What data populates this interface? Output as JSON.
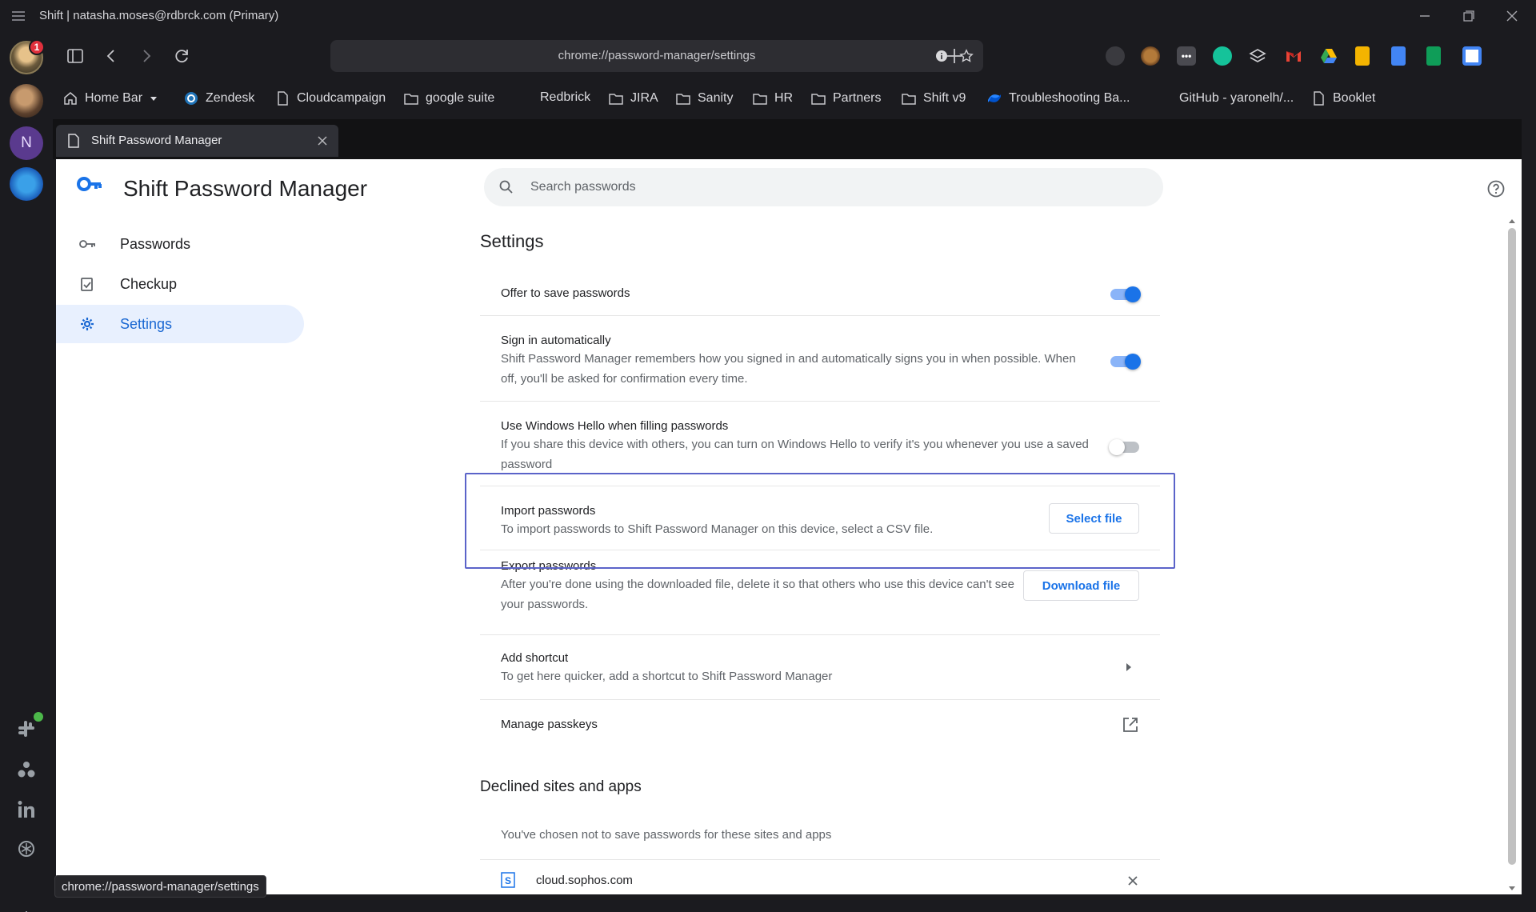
{
  "window": {
    "title": "Shift | natasha.moses@rdbrck.com (Primary)"
  },
  "rail": {
    "badge_count": "1",
    "account_initial": "N"
  },
  "toolbar": {
    "url": "chrome://password-manager/settings"
  },
  "bookmarks": [
    {
      "label": "Home Bar",
      "icon": "home-icon"
    },
    {
      "label": "Zendesk",
      "icon": "zendesk-icon"
    },
    {
      "label": "Cloudcampaign",
      "icon": "page-icon"
    },
    {
      "label": "google suite",
      "icon": "folder-icon"
    },
    {
      "label": "Redbrick",
      "icon": "none"
    },
    {
      "label": "JIRA",
      "icon": "folder-icon"
    },
    {
      "label": "Sanity",
      "icon": "folder-icon"
    },
    {
      "label": "HR",
      "icon": "folder-icon"
    },
    {
      "label": "Partners",
      "icon": "folder-icon"
    },
    {
      "label": "Shift v9",
      "icon": "folder-icon"
    },
    {
      "label": "Troubleshooting Ba...",
      "icon": "confluence-icon"
    },
    {
      "label": "GitHub - yaronelh/...",
      "icon": "github-icon"
    },
    {
      "label": "Booklet",
      "icon": "page-icon"
    }
  ],
  "tab": {
    "label": "Shift Password Manager"
  },
  "app": {
    "name": "Shift Password Manager",
    "search_placeholder": "Search passwords",
    "nav": [
      {
        "label": "Passwords",
        "icon": "key-icon"
      },
      {
        "label": "Checkup",
        "icon": "checkup-icon"
      },
      {
        "label": "Settings",
        "icon": "gear-icon",
        "active": true
      }
    ]
  },
  "settings": {
    "title": "Settings",
    "offer_save": {
      "title": "Offer to save passwords",
      "enabled": true
    },
    "sign_in": {
      "title": "Sign in automatically",
      "desc": "Shift Password Manager remembers how you signed in and automatically signs you in when possible. When off, you'll be asked for confirmation every time.",
      "enabled": true
    },
    "windows_hello": {
      "title": "Use Windows Hello when filling passwords",
      "desc": "If you share this device with others, you can turn on Windows Hello to verify it's you whenever you use a saved password",
      "enabled": false
    },
    "import": {
      "title": "Import passwords",
      "desc": "To import passwords to Shift Password Manager on this device, select a CSV file.",
      "button": "Select file"
    },
    "export": {
      "title": "Export passwords",
      "desc": "After you're done using the downloaded file, delete it so that others who use this device can't see your passwords.",
      "button": "Download file"
    },
    "shortcut": {
      "title": "Add shortcut",
      "desc": "To get here quicker, add a shortcut to Shift Password Manager"
    },
    "passkeys": {
      "title": "Manage passkeys"
    }
  },
  "declined": {
    "title": "Declined sites and apps",
    "desc": "You've chosen not to save passwords for these sites and apps",
    "sites": [
      "cloud.sophos.com"
    ]
  },
  "status": {
    "url": "chrome://password-manager/settings"
  },
  "colors": {
    "accent": "#1a73e8",
    "active_nav_bg": "#e8f0fe",
    "highlight_border": "#5b63c9"
  }
}
